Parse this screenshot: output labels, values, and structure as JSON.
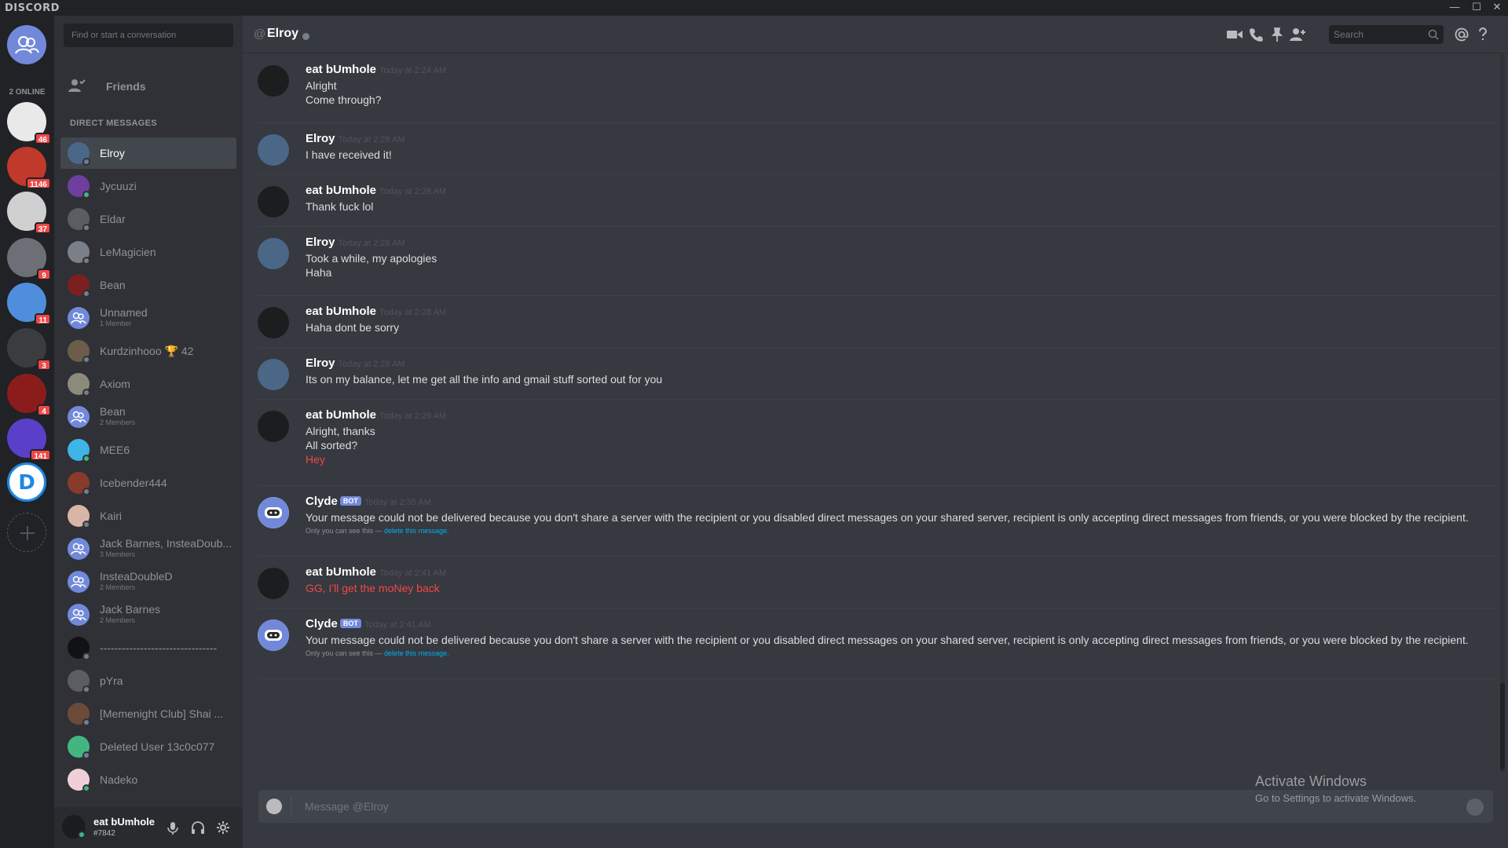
{
  "titlebar": {
    "brand": "DISCORD",
    "minimize": "—",
    "maximize": "☐",
    "close": "✕"
  },
  "rail": {
    "online_label": "2 ONLINE",
    "servers": [
      {
        "badge": "46",
        "color": "#e9e9e9"
      },
      {
        "badge": "1146",
        "color": "#c0392b"
      },
      {
        "badge": "37",
        "color": "#d0d0d0"
      },
      {
        "badge": "9",
        "color": "#6c6f75"
      },
      {
        "badge": "11",
        "color": "#4f8edc"
      },
      {
        "badge": "3",
        "color": "#3a3c40"
      },
      {
        "badge": "4",
        "color": "#8b1c1c"
      },
      {
        "badge": "141",
        "color": "#5a3fc9"
      },
      {
        "badge": "",
        "color": "#ffffff"
      }
    ]
  },
  "dm": {
    "search_placeholder": "Find or start a conversation",
    "friends_label": "Friends",
    "header": "DIRECT MESSAGES",
    "items": [
      {
        "name": "Elroy",
        "sub": "",
        "active": true,
        "status": "#747f8d",
        "color": "#4a6788"
      },
      {
        "name": "Jycuuzi",
        "sub": "",
        "status": "#43b581",
        "color": "#6f3fa0"
      },
      {
        "name": "Eldar",
        "sub": "",
        "status": "#747f8d",
        "color": "#5a5e63"
      },
      {
        "name": "LeMagicien",
        "sub": "",
        "status": "#747f8d",
        "color": "#7a7f88"
      },
      {
        "name": "Bean",
        "sub": "",
        "status": "#747f8d",
        "color": "#7a2020"
      },
      {
        "name": "Unnamed",
        "sub": "1 Member",
        "status": "",
        "color": "#7289da"
      },
      {
        "name": "Kurdzinhooo 🏆 42",
        "sub": "",
        "status": "#747f8d",
        "color": "#6b5d4a"
      },
      {
        "name": "Axiom",
        "sub": "",
        "status": "#747f8d",
        "color": "#8c8a7a"
      },
      {
        "name": "Bean",
        "sub": "2 Members",
        "status": "",
        "color": "#7289da"
      },
      {
        "name": "MEE6",
        "sub": "",
        "status": "#43b581",
        "color": "#3fb4e6"
      },
      {
        "name": "Icebender444",
        "sub": "",
        "status": "#747f8d",
        "color": "#8a3a2a"
      },
      {
        "name": "Kairi",
        "sub": "",
        "status": "#747f8d",
        "color": "#d9b5a8"
      },
      {
        "name": "Jack Barnes, InsteaDoub...",
        "sub": "3 Members",
        "status": "",
        "color": "#7289da"
      },
      {
        "name": "InsteaDoubleD",
        "sub": "2 Members",
        "status": "",
        "color": "#7289da"
      },
      {
        "name": "Jack Barnes",
        "sub": "2 Members",
        "status": "",
        "color": "#7289da"
      },
      {
        "name": "--------------------------------",
        "sub": "",
        "status": "#747f8d",
        "color": "#111214"
      },
      {
        "name": "pYra",
        "sub": "",
        "status": "#747f8d",
        "color": "#5a5e63"
      },
      {
        "name": "[Memenight Club] Shai ...",
        "sub": "",
        "status": "#747f8d",
        "color": "#6b4a3a"
      },
      {
        "name": "Deleted User 13c0c077",
        "sub": "",
        "status": "#747f8d",
        "color": "#43b581"
      },
      {
        "name": "Nadeko",
        "sub": "",
        "status": "#43b581",
        "color": "#f0d0d8"
      }
    ]
  },
  "user": {
    "name": "eat bUmhole",
    "tag": "#7842"
  },
  "header": {
    "at": "@",
    "channel": "Elroy",
    "search_placeholder": "Search"
  },
  "messages": [
    {
      "author": "eat bUmhole",
      "time": "Today at 2:24 AM",
      "bot": false,
      "lines": [
        "Alright",
        "Come through?"
      ],
      "red": [],
      "note": false,
      "av": "#1c1d1f"
    },
    {
      "author": "Elroy",
      "time": "Today at 2:28 AM",
      "bot": false,
      "lines": [
        "I have received it!"
      ],
      "red": [],
      "note": false,
      "av": "#4a6788"
    },
    {
      "author": "eat bUmhole",
      "time": "Today at 2:28 AM",
      "bot": false,
      "lines": [
        "Thank fuck lol"
      ],
      "red": [],
      "note": false,
      "av": "#1c1d1f"
    },
    {
      "author": "Elroy",
      "time": "Today at 2:28 AM",
      "bot": false,
      "lines": [
        "Took a while, my apologies",
        "Haha"
      ],
      "red": [],
      "note": false,
      "av": "#4a6788"
    },
    {
      "author": "eat bUmhole",
      "time": "Today at 2:28 AM",
      "bot": false,
      "lines": [
        "Haha dont be sorry"
      ],
      "red": [],
      "note": false,
      "av": "#1c1d1f"
    },
    {
      "author": "Elroy",
      "time": "Today at 2:28 AM",
      "bot": false,
      "lines": [
        "Its on my balance, let me get all the info and gmail stuff sorted out for you"
      ],
      "red": [],
      "note": false,
      "av": "#4a6788"
    },
    {
      "author": "eat bUmhole",
      "time": "Today at 2:29 AM",
      "bot": false,
      "lines": [
        "Alright, thanks",
        "All sorted?",
        "Hey"
      ],
      "red": [
        2
      ],
      "note": false,
      "av": "#1c1d1f"
    },
    {
      "author": "Clyde",
      "time": "Today at 2:35 AM",
      "bot": true,
      "lines": [
        "Your message could not be delivered because you don't share a server with the recipient or you disabled direct messages on your shared server, recipient is only accepting direct messages from friends, or you were blocked by the recipient."
      ],
      "red": [],
      "note": true,
      "av": "#ffffff"
    },
    {
      "author": "eat bUmhole",
      "time": "Today at 2:41 AM",
      "bot": false,
      "lines": [
        "GG, I'll get the moNey back"
      ],
      "red": [
        0
      ],
      "note": false,
      "av": "#1c1d1f"
    },
    {
      "author": "Clyde",
      "time": "Today at 2:41 AM",
      "bot": true,
      "lines": [
        "Your message could not be delivered because you don't share a server with the recipient or you disabled direct messages on your shared server, recipient is only accepting direct messages from friends, or you were blocked by the recipient."
      ],
      "red": [],
      "note": true,
      "av": "#ffffff"
    }
  ],
  "bot_label": "BOT",
  "note": {
    "prefix": "Only you can see this — ",
    "link": "delete this message."
  },
  "composer": {
    "placeholder": "Message @Elroy"
  },
  "activate": {
    "title": "Activate Windows",
    "subtitle": "Go to Settings to activate Windows."
  }
}
